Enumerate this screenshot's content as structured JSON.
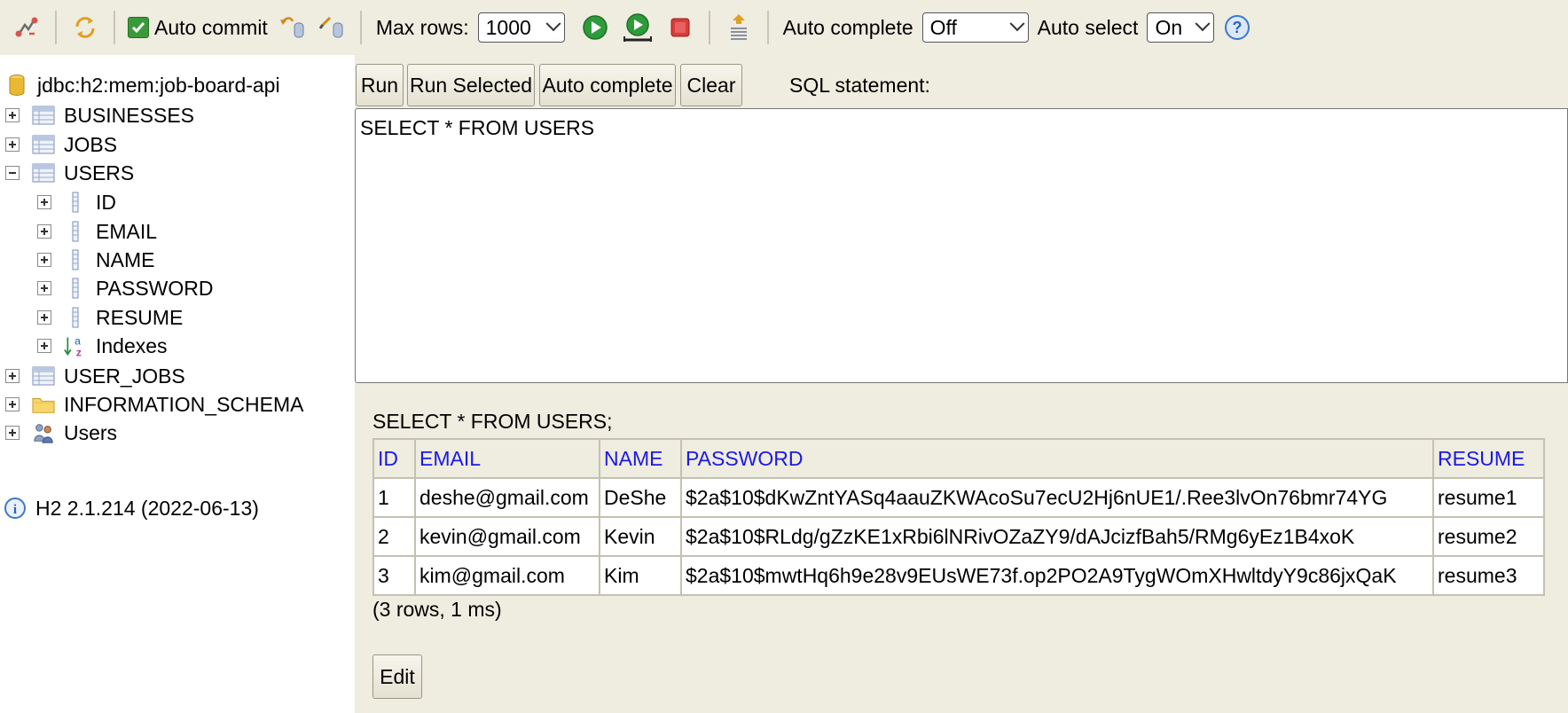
{
  "colors": {
    "panel_bg": "#efece0",
    "header_link": "#1a1ae6",
    "run_green": "#2e9b3a",
    "stop_red": "#d93b3b"
  },
  "toolbar": {
    "icons": [
      "disconnect-icon",
      "refresh-icon",
      "commit-icon",
      "rollback-icon",
      "run-icon",
      "run-selected-icon",
      "stop-icon",
      "history-icon",
      "help-icon"
    ],
    "auto_commit_label": "Auto commit",
    "auto_commit_checked": true,
    "max_rows_label": "Max rows:",
    "max_rows_value": "1000",
    "auto_complete_label": "Auto complete",
    "auto_complete_value": "Off",
    "auto_select_label": "Auto select",
    "auto_select_value": "On"
  },
  "tree": {
    "connection": "jdbc:h2:mem:job-board-api",
    "items": [
      {
        "label": "BUSINESSES",
        "icon": "table-icon",
        "expanded": false
      },
      {
        "label": "JOBS",
        "icon": "table-icon",
        "expanded": false
      },
      {
        "label": "USERS",
        "icon": "table-icon",
        "expanded": true
      },
      {
        "label": "ID",
        "icon": "column-icon",
        "expanded": false
      },
      {
        "label": "EMAIL",
        "icon": "column-icon",
        "expanded": false
      },
      {
        "label": "NAME",
        "icon": "column-icon",
        "expanded": false
      },
      {
        "label": "PASSWORD",
        "icon": "column-icon",
        "expanded": false
      },
      {
        "label": "RESUME",
        "icon": "column-icon",
        "expanded": false
      },
      {
        "label": "Indexes",
        "icon": "index-icon",
        "expanded": false
      },
      {
        "label": "USER_JOBS",
        "icon": "table-icon",
        "expanded": false
      },
      {
        "label": "INFORMATION_SCHEMA",
        "icon": "folder-icon",
        "expanded": false
      },
      {
        "label": "Users",
        "icon": "users-icon",
        "expanded": false
      }
    ],
    "version": "H2 2.1.214 (2022-06-13)"
  },
  "query": {
    "run_label": "Run",
    "run_selected_label": "Run Selected",
    "auto_complete_label": "Auto complete",
    "clear_label": "Clear",
    "sql_statement_label": "SQL statement:",
    "editor_text": "SELECT * FROM USERS"
  },
  "results": {
    "statement": "SELECT * FROM USERS;",
    "columns": [
      "ID",
      "EMAIL",
      "NAME",
      "PASSWORD",
      "RESUME"
    ],
    "rows": [
      [
        "1",
        "deshe@gmail.com",
        "DeShe",
        "$2a$10$dKwZntYASq4aauZKWAcoSu7ecU2Hj6nUE1/.Ree3lvOn76bmr74YG",
        "resume1"
      ],
      [
        "2",
        "kevin@gmail.com",
        "Kevin",
        "$2a$10$RLdg/gZzKE1xRbi6lNRivOZaZY9/dAJcizfBah5/RMg6yEz1B4xoK",
        "resume2"
      ],
      [
        "3",
        "kim@gmail.com",
        "Kim",
        "$2a$10$mwtHq6h9e28v9EUsWE73f.op2PO2A9TygWOmXHwltdyY9c86jxQaK",
        "resume3"
      ]
    ],
    "count_text": "(3 rows, 1 ms)",
    "edit_label": "Edit"
  }
}
